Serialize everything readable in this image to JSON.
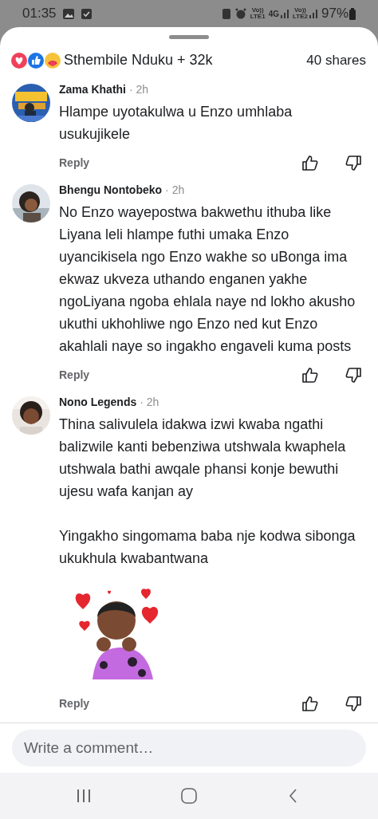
{
  "status_bar": {
    "time": "01:35",
    "network_labels": [
      "Vo))",
      "LTE1",
      "4G",
      "Vo))",
      "LTE2"
    ],
    "battery": "97%"
  },
  "header": {
    "reactions": [
      {
        "kind": "love"
      },
      {
        "kind": "like"
      },
      {
        "kind": "care"
      }
    ],
    "reactors": "Sthembile Nduku + 32k",
    "shares": "40 shares"
  },
  "comments": [
    {
      "author": "Zama Khathi",
      "time": "· 2h",
      "paragraphs": [
        "Hlampe uyotakulwa u Enzo umhlaba usukujikele"
      ],
      "reply": "Reply"
    },
    {
      "author": "Bhengu Nontobeko",
      "time": "· 2h",
      "paragraphs": [
        "No Enzo wayepostwa bakwethu ithuba like Liyana leli hlampe futhi umaka Enzo uyancikisela ngo Enzo wakhe so uBonga ima ekwaz ukveza uthando enganen yakhe ngoLiyana ngoba ehlala naye nd lokho akusho ukuthi ukhohliwe ngo Enzo ned kut Enzo akahlali naye so ingakho engaveli kuma posts"
      ],
      "reply": "Reply"
    },
    {
      "author": "Nono Legends",
      "time": "· 2h",
      "paragraphs": [
        "Thina salivulela idakwa izwi kwaba ngathi balizwile kanti bebenziwa utshwala kwaphela utshwala bathi awqale phansi konje bewuthi ujesu wafa kanjan ay",
        "Yingakho singomama baba nje kodwa sibonga ukukhula kwabantwana"
      ],
      "attachment": {
        "kind": "sticker"
      },
      "reply": "Reply"
    }
  ],
  "composer": {
    "placeholder": "Write a comment…"
  }
}
